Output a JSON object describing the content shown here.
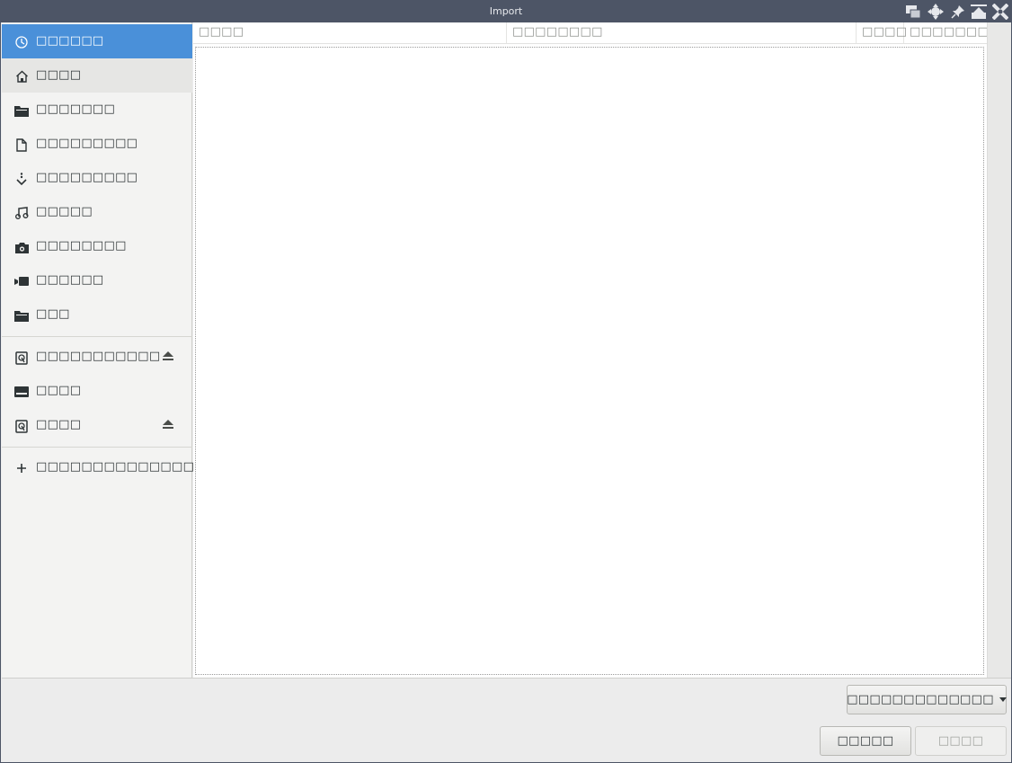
{
  "window": {
    "title": "Import"
  },
  "sidebar": {
    "places": [
      {
        "label": "□□□□□□",
        "icon": "clock-icon"
      },
      {
        "label": "□□□□",
        "icon": "home-icon"
      },
      {
        "label": "□□□□□□□",
        "icon": "folder-icon"
      },
      {
        "label": "□□□□□□□□□",
        "icon": "document-icon"
      },
      {
        "label": "□□□□□□□□□",
        "icon": "download-icon"
      },
      {
        "label": "□□□□□",
        "icon": "music-icon"
      },
      {
        "label": "□□□□□□□□",
        "icon": "camera-icon"
      },
      {
        "label": "□□□□□□",
        "icon": "video-icon"
      },
      {
        "label": "□□□",
        "icon": "folder-icon"
      }
    ],
    "devices": [
      {
        "label": "□□□□□□□□□□□",
        "icon": "drive-icon",
        "ejectable": true
      },
      {
        "label": "□□□□",
        "icon": "harddisk-icon",
        "ejectable": false
      },
      {
        "label": "□□□□",
        "icon": "drive-icon",
        "ejectable": true
      }
    ],
    "other": {
      "label": "□□□□□□□□□□□□□□□",
      "icon": "plus-icon"
    }
  },
  "filelist": {
    "columns": [
      "□□□□",
      "□□□□□□□□",
      "□□□□",
      "□□□□□□□"
    ]
  },
  "footer": {
    "filter_label": "□□□□□□□□□□□□□",
    "cancel_label": "□□□□□",
    "open_label": "□□□□"
  }
}
